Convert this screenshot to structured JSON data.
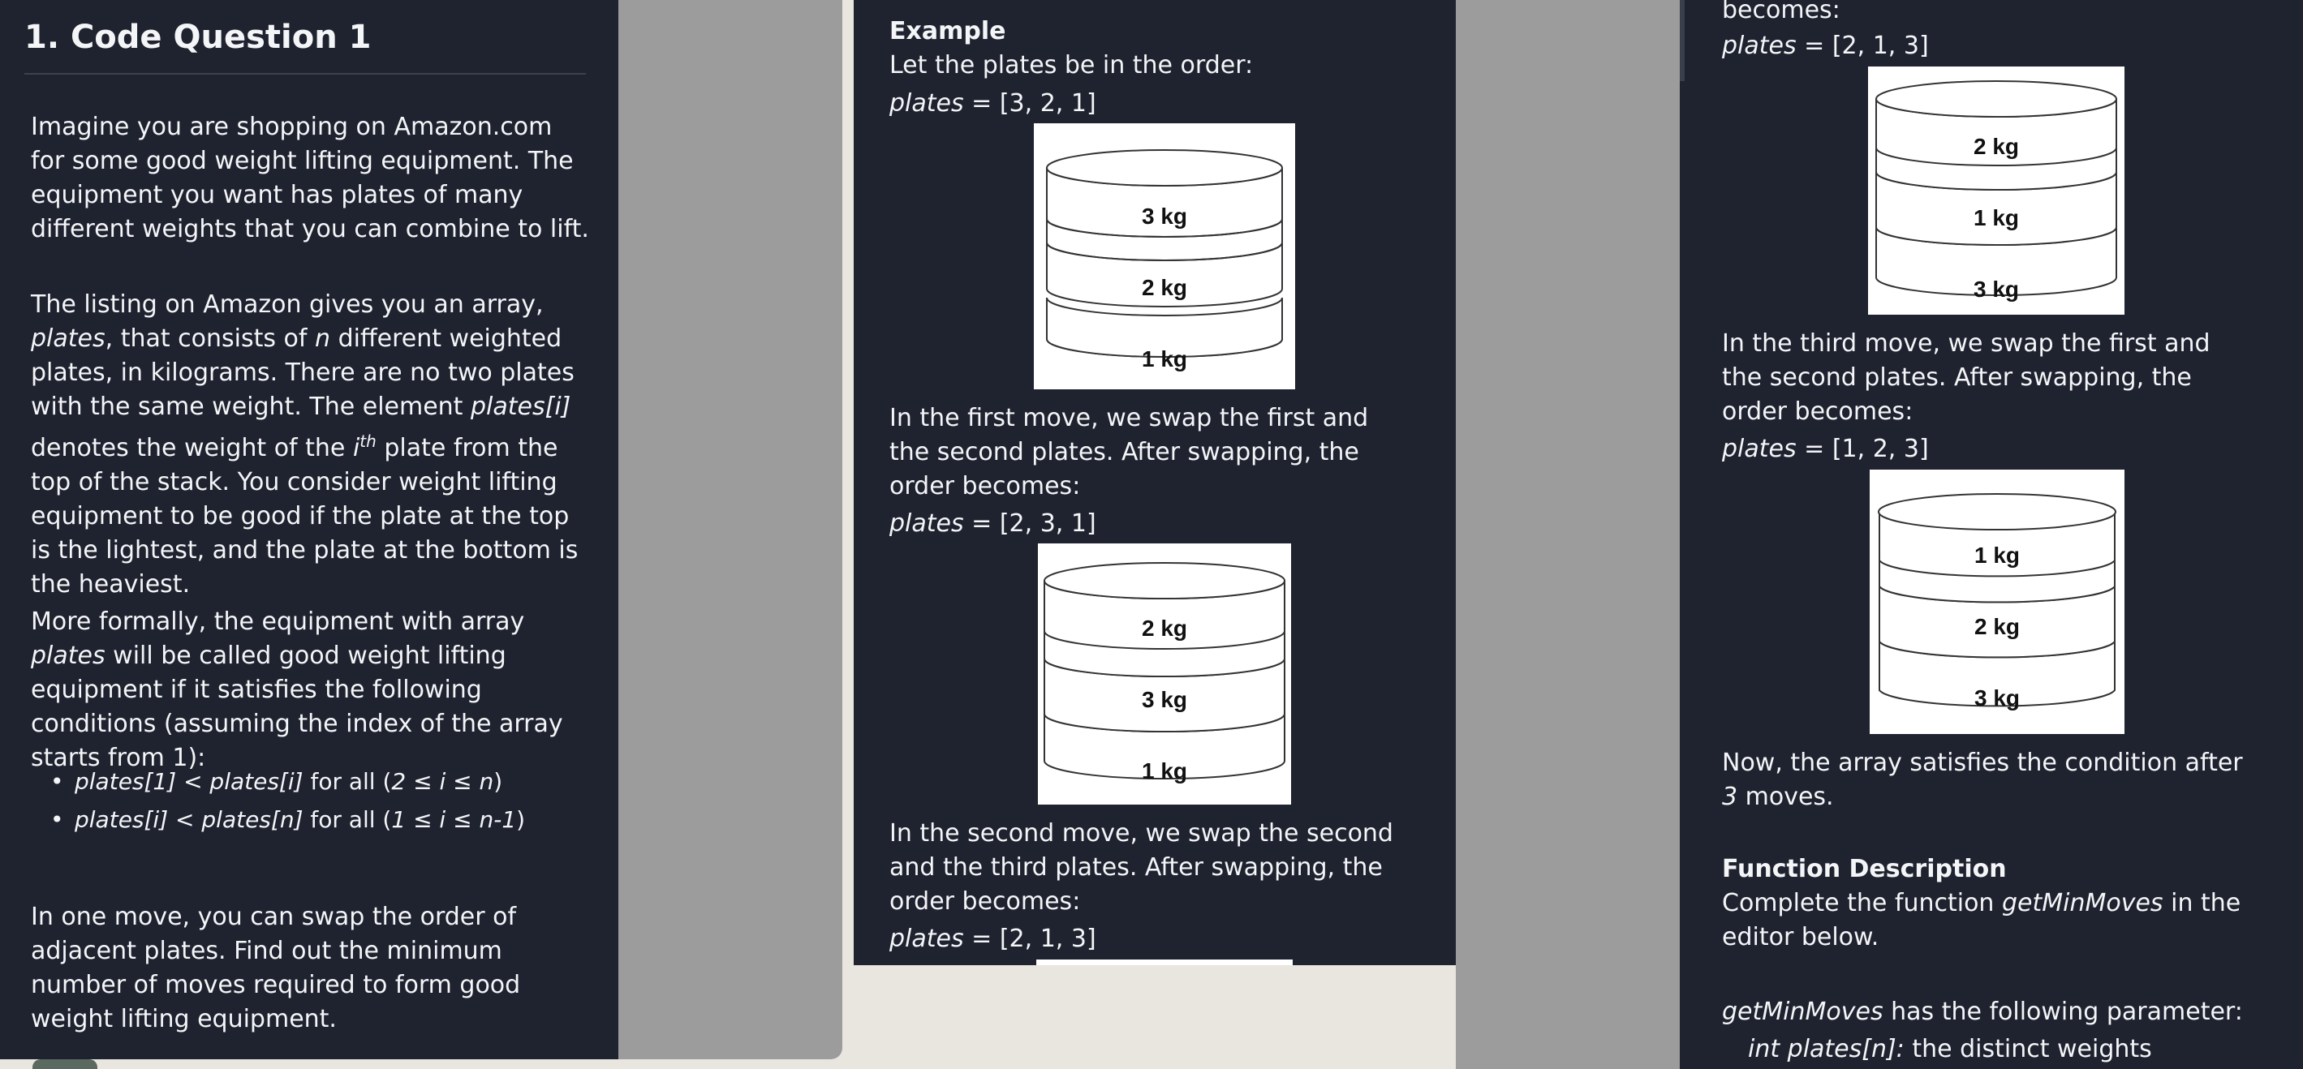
{
  "left": {
    "title": "1. Code Question 1",
    "p1": "Imagine you are shopping on Amazon.com for some good weight lifting equipment. The equipment you want has plates of many different weights that you can combine to lift.",
    "p2_a": "The listing on Amazon gives you an array,",
    "p2_b": "plates",
    "p2_c": ", that consists of",
    "p2_d": "n",
    "p2_e": "different weighted plates, in kilograms. There are no two plates with the same weight. The element",
    "p2_f": "plates[i]",
    "p2_g": "denotes the weight of the",
    "p2_h": "i",
    "p2_sup": "th",
    "p2_i": "plate from the top of the stack. You consider weight lifting equipment to be good if the plate at the top is the lightest, and the plate at the bottom is the heaviest.",
    "p3_a": "More formally, the equipment with array",
    "p3_b": "plates",
    "p3_c": "will be called good weight lifting equipment if it satisfies the following conditions (assuming the index of the array starts from 1):",
    "bullet1_a": "plates[1] < plates[i]",
    "bullet1_b": "for all (",
    "bullet1_c": "2 ≤ i ≤ n",
    "bullet1_d": ")",
    "bullet2_a": "plates[i] < plates[n]",
    "bullet2_b": "for all (",
    "bullet2_c": "1 ≤ i ≤ n-1",
    "bullet2_d": ")",
    "p4": "In one move, you can swap the order of adjacent plates. Find out the minimum number of moves required to form good weight lifting equipment."
  },
  "middle": {
    "example": "Example",
    "let": "Let the plates be in the order:",
    "var": "plates",
    "arr0": " = [3, 2, 1]",
    "img0": [
      "3 kg",
      "2 kg",
      "1 kg"
    ],
    "move1": "In the first move, we swap the first and the second plates. After swapping, the order becomes:",
    "arr1": " = [2, 3, 1]",
    "img1": [
      "2 kg",
      "3 kg",
      "1 kg"
    ],
    "move2": "In the second move, we swap the second and the third plates. After swapping, the order becomes:",
    "arr2": " = [2, 1, 3]"
  },
  "right": {
    "becomes": "becomes:",
    "var": "plates",
    "arr2": " = [2, 1, 3]",
    "img2": [
      "2 kg",
      "1 kg",
      "3 kg"
    ],
    "move3": "In the third move, we swap the first and the second plates. After swapping, the order becomes:",
    "arr3": " = [1, 2, 3]",
    "img3": [
      "1 kg",
      "2 kg",
      "3 kg"
    ],
    "now_a": "Now, the array satisfies the condition after",
    "now_b": "3",
    "now_c": "moves.",
    "fd_heading": "Function Description",
    "fd_a": "Complete the function",
    "fd_b": "getMinMoves",
    "fd_c": "in the editor below.",
    "param_a": "getMinMoves",
    "param_b": "has the following parameter:",
    "param2_a": "int plates[n]:",
    "param2_b": "the distinct weights"
  }
}
